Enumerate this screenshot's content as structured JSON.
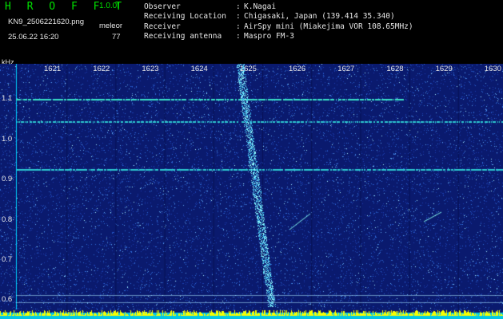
{
  "app": {
    "logo": "H R O F F T",
    "version": "1.0.0f"
  },
  "file": {
    "name": "KN9_2506221620.png",
    "mode": "meleor",
    "datetime": "25.06.22 16:20",
    "count": "77"
  },
  "info": [
    {
      "key": "Observer",
      "value": "K.Nagai"
    },
    {
      "key": "Receiving Location",
      "value": "Chigasaki, Japan (139.414 35.340)"
    },
    {
      "key": "Receiver",
      "value": "AirSpy mini (Miakejima VOR 108.65MHz)"
    },
    {
      "key": "Receiving antenna",
      "value": "Maspro FM-3"
    }
  ],
  "axis": {
    "y_unit": "kHz",
    "x_ticks": [
      "1621",
      "1622",
      "1623",
      "1624",
      "1625",
      "1626",
      "1627",
      "1628",
      "1629",
      "1630"
    ],
    "y_ticks": [
      "1.1",
      "1.0",
      "0.9",
      "0.8",
      "0.7",
      "0.6"
    ]
  },
  "colors": {
    "background": "#0a1a6e",
    "signal": "#00ffff",
    "baseline": "#ffff00",
    "text": "#e6e6e6",
    "logo": "#00e000"
  }
}
